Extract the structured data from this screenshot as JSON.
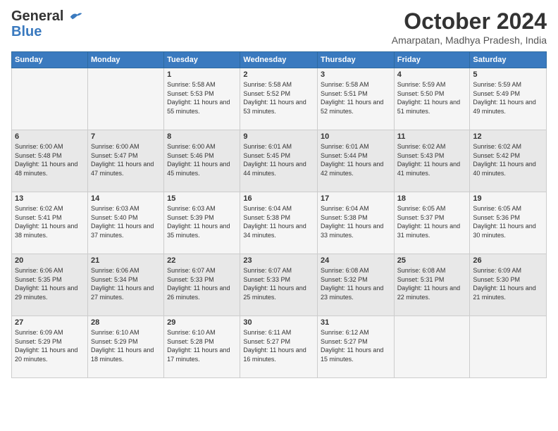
{
  "header": {
    "logo_line1": "General",
    "logo_line2": "Blue",
    "title": "October 2024",
    "subtitle": "Amarpatan, Madhya Pradesh, India"
  },
  "weekdays": [
    "Sunday",
    "Monday",
    "Tuesday",
    "Wednesday",
    "Thursday",
    "Friday",
    "Saturday"
  ],
  "weeks": [
    [
      {
        "day": "",
        "info": ""
      },
      {
        "day": "",
        "info": ""
      },
      {
        "day": "1",
        "info": "Sunrise: 5:58 AM\nSunset: 5:53 PM\nDaylight: 11 hours and 55 minutes."
      },
      {
        "day": "2",
        "info": "Sunrise: 5:58 AM\nSunset: 5:52 PM\nDaylight: 11 hours and 53 minutes."
      },
      {
        "day": "3",
        "info": "Sunrise: 5:58 AM\nSunset: 5:51 PM\nDaylight: 11 hours and 52 minutes."
      },
      {
        "day": "4",
        "info": "Sunrise: 5:59 AM\nSunset: 5:50 PM\nDaylight: 11 hours and 51 minutes."
      },
      {
        "day": "5",
        "info": "Sunrise: 5:59 AM\nSunset: 5:49 PM\nDaylight: 11 hours and 49 minutes."
      }
    ],
    [
      {
        "day": "6",
        "info": "Sunrise: 6:00 AM\nSunset: 5:48 PM\nDaylight: 11 hours and 48 minutes."
      },
      {
        "day": "7",
        "info": "Sunrise: 6:00 AM\nSunset: 5:47 PM\nDaylight: 11 hours and 47 minutes."
      },
      {
        "day": "8",
        "info": "Sunrise: 6:00 AM\nSunset: 5:46 PM\nDaylight: 11 hours and 45 minutes."
      },
      {
        "day": "9",
        "info": "Sunrise: 6:01 AM\nSunset: 5:45 PM\nDaylight: 11 hours and 44 minutes."
      },
      {
        "day": "10",
        "info": "Sunrise: 6:01 AM\nSunset: 5:44 PM\nDaylight: 11 hours and 42 minutes."
      },
      {
        "day": "11",
        "info": "Sunrise: 6:02 AM\nSunset: 5:43 PM\nDaylight: 11 hours and 41 minutes."
      },
      {
        "day": "12",
        "info": "Sunrise: 6:02 AM\nSunset: 5:42 PM\nDaylight: 11 hours and 40 minutes."
      }
    ],
    [
      {
        "day": "13",
        "info": "Sunrise: 6:02 AM\nSunset: 5:41 PM\nDaylight: 11 hours and 38 minutes."
      },
      {
        "day": "14",
        "info": "Sunrise: 6:03 AM\nSunset: 5:40 PM\nDaylight: 11 hours and 37 minutes."
      },
      {
        "day": "15",
        "info": "Sunrise: 6:03 AM\nSunset: 5:39 PM\nDaylight: 11 hours and 35 minutes."
      },
      {
        "day": "16",
        "info": "Sunrise: 6:04 AM\nSunset: 5:38 PM\nDaylight: 11 hours and 34 minutes."
      },
      {
        "day": "17",
        "info": "Sunrise: 6:04 AM\nSunset: 5:38 PM\nDaylight: 11 hours and 33 minutes."
      },
      {
        "day": "18",
        "info": "Sunrise: 6:05 AM\nSunset: 5:37 PM\nDaylight: 11 hours and 31 minutes."
      },
      {
        "day": "19",
        "info": "Sunrise: 6:05 AM\nSunset: 5:36 PM\nDaylight: 11 hours and 30 minutes."
      }
    ],
    [
      {
        "day": "20",
        "info": "Sunrise: 6:06 AM\nSunset: 5:35 PM\nDaylight: 11 hours and 29 minutes."
      },
      {
        "day": "21",
        "info": "Sunrise: 6:06 AM\nSunset: 5:34 PM\nDaylight: 11 hours and 27 minutes."
      },
      {
        "day": "22",
        "info": "Sunrise: 6:07 AM\nSunset: 5:33 PM\nDaylight: 11 hours and 26 minutes."
      },
      {
        "day": "23",
        "info": "Sunrise: 6:07 AM\nSunset: 5:33 PM\nDaylight: 11 hours and 25 minutes."
      },
      {
        "day": "24",
        "info": "Sunrise: 6:08 AM\nSunset: 5:32 PM\nDaylight: 11 hours and 23 minutes."
      },
      {
        "day": "25",
        "info": "Sunrise: 6:08 AM\nSunset: 5:31 PM\nDaylight: 11 hours and 22 minutes."
      },
      {
        "day": "26",
        "info": "Sunrise: 6:09 AM\nSunset: 5:30 PM\nDaylight: 11 hours and 21 minutes."
      }
    ],
    [
      {
        "day": "27",
        "info": "Sunrise: 6:09 AM\nSunset: 5:29 PM\nDaylight: 11 hours and 20 minutes."
      },
      {
        "day": "28",
        "info": "Sunrise: 6:10 AM\nSunset: 5:29 PM\nDaylight: 11 hours and 18 minutes."
      },
      {
        "day": "29",
        "info": "Sunrise: 6:10 AM\nSunset: 5:28 PM\nDaylight: 11 hours and 17 minutes."
      },
      {
        "day": "30",
        "info": "Sunrise: 6:11 AM\nSunset: 5:27 PM\nDaylight: 11 hours and 16 minutes."
      },
      {
        "day": "31",
        "info": "Sunrise: 6:12 AM\nSunset: 5:27 PM\nDaylight: 11 hours and 15 minutes."
      },
      {
        "day": "",
        "info": ""
      },
      {
        "day": "",
        "info": ""
      }
    ]
  ]
}
